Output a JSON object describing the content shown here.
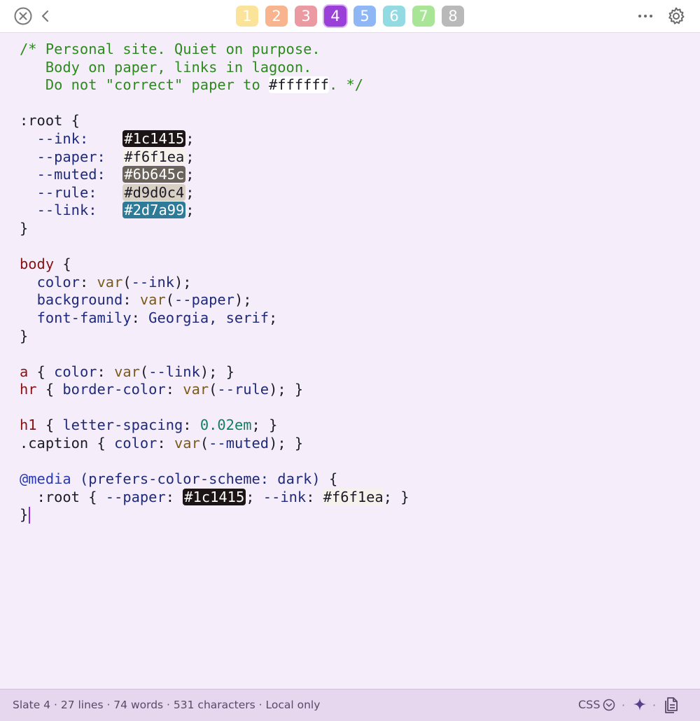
{
  "toolbar": {
    "close_icon": "close-circle-icon",
    "back_icon": "chevron-left-icon",
    "more_icon": "ellipsis-icon",
    "settings_icon": "gear-icon"
  },
  "tabs": [
    {
      "label": "1",
      "color": "#fbe39a",
      "active": false
    },
    {
      "label": "2",
      "color": "#f7b48f",
      "active": false
    },
    {
      "label": "3",
      "color": "#ec9aa2",
      "active": false
    },
    {
      "label": "4",
      "color": "#9b3fd9",
      "active": true
    },
    {
      "label": "5",
      "color": "#8fb6f5",
      "active": false
    },
    {
      "label": "6",
      "color": "#93dbe3",
      "active": false
    },
    {
      "label": "7",
      "color": "#a9e596",
      "active": false
    },
    {
      "label": "8",
      "color": "#b9b9b9",
      "active": false
    }
  ],
  "code": {
    "comment": [
      "/* Personal site. Quiet on purpose.",
      "   Body on paper, links in lagoon.",
      "   Do not \"correct\" paper to ",
      "#ffffff",
      ". */"
    ],
    "root_sel": ":root",
    "vars": [
      {
        "name": "--ink:",
        "pad": "    ",
        "value": "#1c1415",
        "bg": "#1c1415",
        "fg": "#ffffff"
      },
      {
        "name": "--paper:",
        "pad": "  ",
        "value": "#f6f1ea",
        "bg": "#f6f1ea",
        "fg": "#1c1b2a"
      },
      {
        "name": "--muted:",
        "pad": "  ",
        "value": "#6b645c",
        "bg": "#6b645c",
        "fg": "#ffffff"
      },
      {
        "name": "--rule:",
        "pad": "   ",
        "value": "#d9d0c4",
        "bg": "#d9d0c4",
        "fg": "#1c1b2a"
      },
      {
        "name": "--link:",
        "pad": "   ",
        "value": "#2d7a99",
        "bg": "#2d7a99",
        "fg": "#ffffff"
      }
    ],
    "body_sel": "body",
    "body_props": [
      {
        "prop": "color",
        "fn": "var",
        "arg": "--ink"
      },
      {
        "prop": "background",
        "fn": "var",
        "arg": "--paper"
      }
    ],
    "font_prop": "font-family",
    "font_value": "Georgia, serif",
    "a_sel": "a",
    "a_prop": "color",
    "a_arg": "--link",
    "hr_sel": "hr",
    "hr_prop": "border-color",
    "hr_arg": "--rule",
    "h1_sel": "h1",
    "h1_prop": "letter-spacing",
    "h1_value": "0.02em",
    "caption_sel": ".caption",
    "caption_prop": "color",
    "caption_arg": "--muted",
    "media_kw": "@media",
    "media_query": "(prefers-color-scheme: dark)",
    "dark_root": ":root",
    "dark_paper_prop": "--paper",
    "dark_paper_value": "#1c1415",
    "dark_ink_prop": "--ink",
    "dark_ink_value": "#f6f1ea",
    "fn_name": "var"
  },
  "status": {
    "text": "Slate 4 · 27 lines · 74 words · 531 characters · Local only",
    "language": "CSS",
    "sep": "·"
  }
}
